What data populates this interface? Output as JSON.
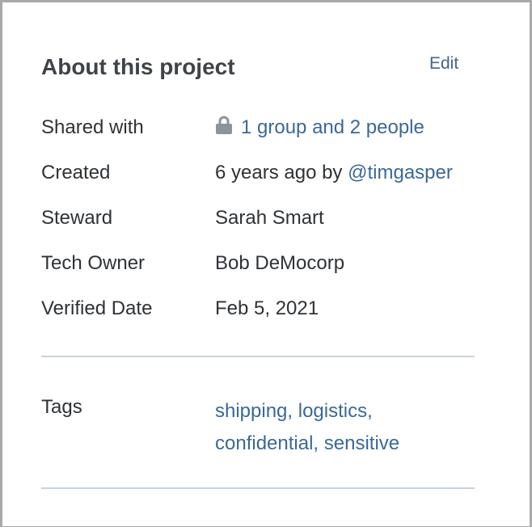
{
  "panel": {
    "title": "About this project",
    "edit_label": "Edit"
  },
  "details": {
    "shared_with": {
      "label": "Shared with",
      "value": "1 group and 2 people",
      "icon": "lock-icon"
    },
    "created": {
      "label": "Created",
      "value_prefix": "6 years ago by ",
      "user": "@timgasper"
    },
    "steward": {
      "label": "Steward",
      "value": "Sarah Smart"
    },
    "tech_owner": {
      "label": "Tech Owner",
      "value": "Bob DeMocorp"
    },
    "verified_date": {
      "label": "Verified Date",
      "value": "Feb 5, 2021"
    }
  },
  "tags": {
    "label": "Tags",
    "items": [
      "shipping,",
      "logistics,",
      "confidential,",
      "sensitive"
    ]
  },
  "colors": {
    "link": "#3b6899",
    "text": "#2e3236",
    "divider": "#c9d3dc"
  }
}
